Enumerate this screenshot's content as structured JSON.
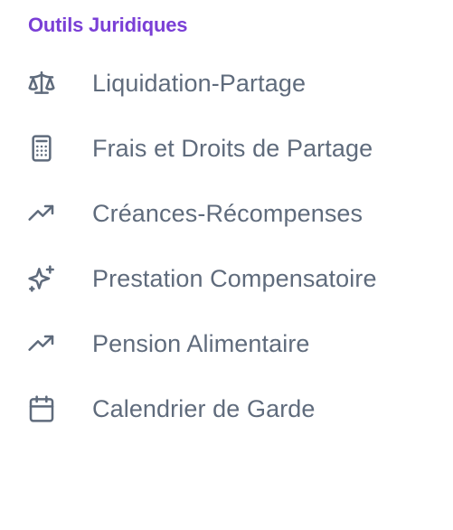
{
  "section": {
    "title": "Outils Juridiques"
  },
  "nav": {
    "items": [
      {
        "label": "Liquidation-Partage",
        "icon": "scale-icon"
      },
      {
        "label": "Frais et Droits de Partage",
        "icon": "calculator-icon"
      },
      {
        "label": "Créances-Récompenses",
        "icon": "trending-up-icon"
      },
      {
        "label": "Prestation Compensatoire",
        "icon": "sparkles-icon"
      },
      {
        "label": "Pension Alimentaire",
        "icon": "trending-up-icon"
      },
      {
        "label": "Calendrier de Garde",
        "icon": "calendar-icon"
      }
    ]
  },
  "colors": {
    "accent": "#7a3fd6",
    "text": "#5f6b7c",
    "icon": "#5f6b7c",
    "background": "#ffffff"
  }
}
